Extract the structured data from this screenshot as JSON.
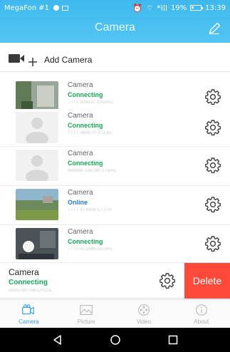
{
  "statusbar": {
    "carrier": "MegaFon #1",
    "signal_text": "*ill",
    "battery": "19%",
    "time": "13:39"
  },
  "header": {
    "title": "Camera",
    "edit_icon": "pencil-icon"
  },
  "add_camera": {
    "label": "Add Camera",
    "icon": "camera-add-icon"
  },
  "cameras": [
    {
      "name": "Camera",
      "status": "Connecting",
      "id": "TTTT-804837-CHHHJ",
      "status_color": "#19a85a",
      "thumb": "outdoor-greenery"
    },
    {
      "name": "Camera",
      "status": "Connecting",
      "id": "TTTT-986570-BTEML",
      "status_color": "#19a85a",
      "thumb": "placeholder"
    },
    {
      "name": "Camera",
      "status": "Connecting",
      "id": "MMMM-334790-STBAE",
      "status_color": "#19a85a",
      "thumb": "placeholder"
    },
    {
      "name": "Camera",
      "status": "Online",
      "id": "TTTT-874994-CTJTP",
      "status_color": "#2a7bd5",
      "thumb": "landscape"
    },
    {
      "name": "Camera",
      "status": "Connecting",
      "id": "TTTT-472986-AZUPE",
      "status_color": "#19a85a",
      "thumb": "dark-room"
    }
  ],
  "swipe_item": {
    "name": "Camera",
    "status": "Connecting",
    "id": "SSSS-007798-CPCCE",
    "delete_label": "Delete"
  },
  "tabs": [
    {
      "label": "Camera",
      "icon": "camera-tab-icon",
      "active": true
    },
    {
      "label": "Picture",
      "icon": "picture-tab-icon",
      "active": false
    },
    {
      "label": "Video",
      "icon": "video-tab-icon",
      "active": false
    },
    {
      "label": "About",
      "icon": "info-tab-icon",
      "active": false
    }
  ],
  "colors": {
    "header": "#45bdef",
    "accent": "#3aa6e2",
    "connecting": "#19a85a",
    "online": "#2a7bd5",
    "delete": "#ff4a3b"
  }
}
